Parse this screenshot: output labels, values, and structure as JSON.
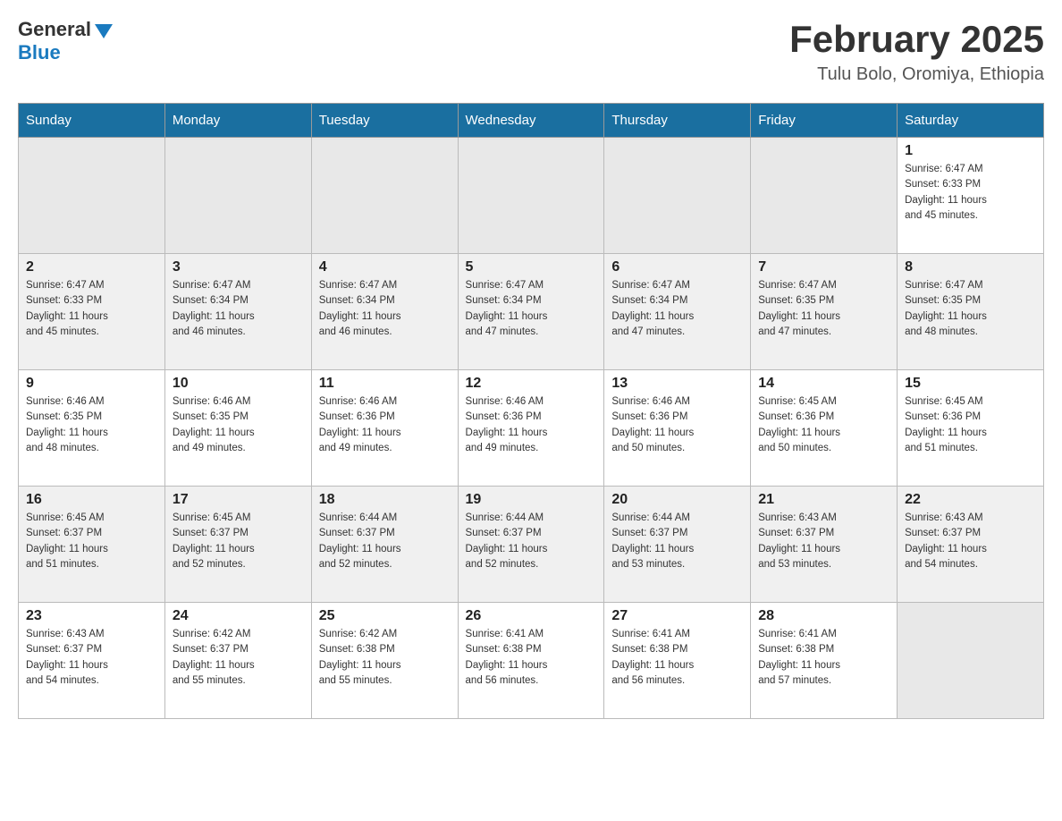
{
  "header": {
    "logo_general": "General",
    "logo_blue": "Blue",
    "month_title": "February 2025",
    "location": "Tulu Bolo, Oromiya, Ethiopia"
  },
  "weekdays": [
    "Sunday",
    "Monday",
    "Tuesday",
    "Wednesday",
    "Thursday",
    "Friday",
    "Saturday"
  ],
  "weeks": [
    [
      {
        "day": "",
        "info": ""
      },
      {
        "day": "",
        "info": ""
      },
      {
        "day": "",
        "info": ""
      },
      {
        "day": "",
        "info": ""
      },
      {
        "day": "",
        "info": ""
      },
      {
        "day": "",
        "info": ""
      },
      {
        "day": "1",
        "info": "Sunrise: 6:47 AM\nSunset: 6:33 PM\nDaylight: 11 hours\nand 45 minutes."
      }
    ],
    [
      {
        "day": "2",
        "info": "Sunrise: 6:47 AM\nSunset: 6:33 PM\nDaylight: 11 hours\nand 45 minutes."
      },
      {
        "day": "3",
        "info": "Sunrise: 6:47 AM\nSunset: 6:34 PM\nDaylight: 11 hours\nand 46 minutes."
      },
      {
        "day": "4",
        "info": "Sunrise: 6:47 AM\nSunset: 6:34 PM\nDaylight: 11 hours\nand 46 minutes."
      },
      {
        "day": "5",
        "info": "Sunrise: 6:47 AM\nSunset: 6:34 PM\nDaylight: 11 hours\nand 47 minutes."
      },
      {
        "day": "6",
        "info": "Sunrise: 6:47 AM\nSunset: 6:34 PM\nDaylight: 11 hours\nand 47 minutes."
      },
      {
        "day": "7",
        "info": "Sunrise: 6:47 AM\nSunset: 6:35 PM\nDaylight: 11 hours\nand 47 minutes."
      },
      {
        "day": "8",
        "info": "Sunrise: 6:47 AM\nSunset: 6:35 PM\nDaylight: 11 hours\nand 48 minutes."
      }
    ],
    [
      {
        "day": "9",
        "info": "Sunrise: 6:46 AM\nSunset: 6:35 PM\nDaylight: 11 hours\nand 48 minutes."
      },
      {
        "day": "10",
        "info": "Sunrise: 6:46 AM\nSunset: 6:35 PM\nDaylight: 11 hours\nand 49 minutes."
      },
      {
        "day": "11",
        "info": "Sunrise: 6:46 AM\nSunset: 6:36 PM\nDaylight: 11 hours\nand 49 minutes."
      },
      {
        "day": "12",
        "info": "Sunrise: 6:46 AM\nSunset: 6:36 PM\nDaylight: 11 hours\nand 49 minutes."
      },
      {
        "day": "13",
        "info": "Sunrise: 6:46 AM\nSunset: 6:36 PM\nDaylight: 11 hours\nand 50 minutes."
      },
      {
        "day": "14",
        "info": "Sunrise: 6:45 AM\nSunset: 6:36 PM\nDaylight: 11 hours\nand 50 minutes."
      },
      {
        "day": "15",
        "info": "Sunrise: 6:45 AM\nSunset: 6:36 PM\nDaylight: 11 hours\nand 51 minutes."
      }
    ],
    [
      {
        "day": "16",
        "info": "Sunrise: 6:45 AM\nSunset: 6:37 PM\nDaylight: 11 hours\nand 51 minutes."
      },
      {
        "day": "17",
        "info": "Sunrise: 6:45 AM\nSunset: 6:37 PM\nDaylight: 11 hours\nand 52 minutes."
      },
      {
        "day": "18",
        "info": "Sunrise: 6:44 AM\nSunset: 6:37 PM\nDaylight: 11 hours\nand 52 minutes."
      },
      {
        "day": "19",
        "info": "Sunrise: 6:44 AM\nSunset: 6:37 PM\nDaylight: 11 hours\nand 52 minutes."
      },
      {
        "day": "20",
        "info": "Sunrise: 6:44 AM\nSunset: 6:37 PM\nDaylight: 11 hours\nand 53 minutes."
      },
      {
        "day": "21",
        "info": "Sunrise: 6:43 AM\nSunset: 6:37 PM\nDaylight: 11 hours\nand 53 minutes."
      },
      {
        "day": "22",
        "info": "Sunrise: 6:43 AM\nSunset: 6:37 PM\nDaylight: 11 hours\nand 54 minutes."
      }
    ],
    [
      {
        "day": "23",
        "info": "Sunrise: 6:43 AM\nSunset: 6:37 PM\nDaylight: 11 hours\nand 54 minutes."
      },
      {
        "day": "24",
        "info": "Sunrise: 6:42 AM\nSunset: 6:37 PM\nDaylight: 11 hours\nand 55 minutes."
      },
      {
        "day": "25",
        "info": "Sunrise: 6:42 AM\nSunset: 6:38 PM\nDaylight: 11 hours\nand 55 minutes."
      },
      {
        "day": "26",
        "info": "Sunrise: 6:41 AM\nSunset: 6:38 PM\nDaylight: 11 hours\nand 56 minutes."
      },
      {
        "day": "27",
        "info": "Sunrise: 6:41 AM\nSunset: 6:38 PM\nDaylight: 11 hours\nand 56 minutes."
      },
      {
        "day": "28",
        "info": "Sunrise: 6:41 AM\nSunset: 6:38 PM\nDaylight: 11 hours\nand 57 minutes."
      },
      {
        "day": "",
        "info": ""
      }
    ]
  ]
}
